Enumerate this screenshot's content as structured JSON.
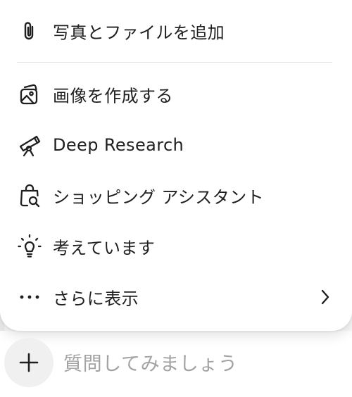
{
  "menu": {
    "items": [
      {
        "label": "写真とファイルを追加",
        "icon": "paperclip-icon"
      },
      {
        "label": "画像を作成する",
        "icon": "image-create-icon"
      },
      {
        "label": "Deep Research",
        "icon": "telescope-icon"
      },
      {
        "label": "ショッピング アシスタント",
        "icon": "shopping-bag-search-icon"
      },
      {
        "label": "考えています",
        "icon": "lightbulb-icon"
      },
      {
        "label": "さらに表示",
        "icon": "more-dots-icon",
        "submenu_icon": "chevron-right-icon"
      }
    ]
  },
  "composer": {
    "placeholder": "質問してみましょう",
    "add_icon": "plus-icon"
  }
}
